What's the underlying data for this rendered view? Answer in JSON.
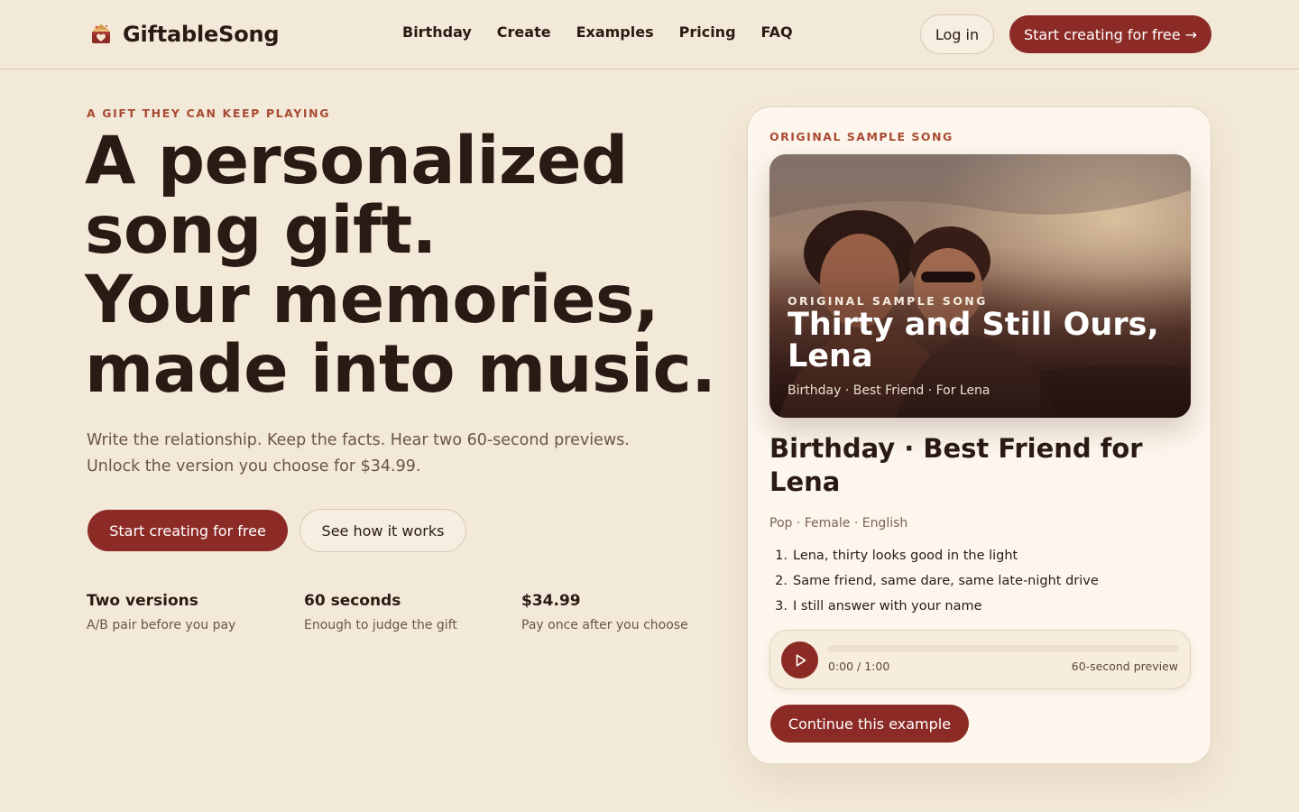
{
  "header": {
    "brand_name": "GiftableSong",
    "nav": [
      "Birthday",
      "Create",
      "Examples",
      "Pricing",
      "FAQ"
    ],
    "login_label": "Log in",
    "cta_label": "Start creating for free →"
  },
  "hero": {
    "eyebrow": "A GIFT THEY CAN KEEP PLAYING",
    "headline_lines": [
      "A personalized",
      "song gift.",
      "Your memories,",
      "made into music."
    ],
    "subcopy_lines": [
      "Write the relationship. Keep the facts. Hear two 60-second previews.",
      "Unlock the version you choose for $34.99."
    ],
    "primary_button": "Start creating for free",
    "secondary_button": "See how it works",
    "stats": [
      {
        "title": "Two versions",
        "desc": "A/B pair before you pay"
      },
      {
        "title": "60 seconds",
        "desc": "Enough to judge the gift"
      },
      {
        "title": "$34.99",
        "desc": "Pay once after you choose"
      }
    ]
  },
  "sample": {
    "eyebrow": "ORIGINAL SAMPLE SONG",
    "cover": {
      "eyebrow": "ORIGINAL SAMPLE SONG",
      "title": "Thirty and Still Ours, Lena",
      "subtitle": "Birthday · Best Friend · For Lena"
    },
    "song_title": "Birthday · Best Friend for Lena",
    "meta": "Pop · Female · English",
    "lyrics": [
      "Lena, thirty looks good in the light",
      "Same friend, same dare, same late-night drive",
      "I still answer with your name"
    ],
    "player": {
      "time": "0:00 / 1:00",
      "label": "60-second preview",
      "progress": 0
    },
    "continue_button": "Continue this example"
  },
  "colors": {
    "background": "#f3e9d9",
    "accent": "#8c2b26",
    "eyebrow": "#a84b34",
    "text": "#2a1a14",
    "card": "#fdf6ec"
  },
  "icons": {
    "brand": "gift-heart-icon",
    "play": "play-icon"
  }
}
